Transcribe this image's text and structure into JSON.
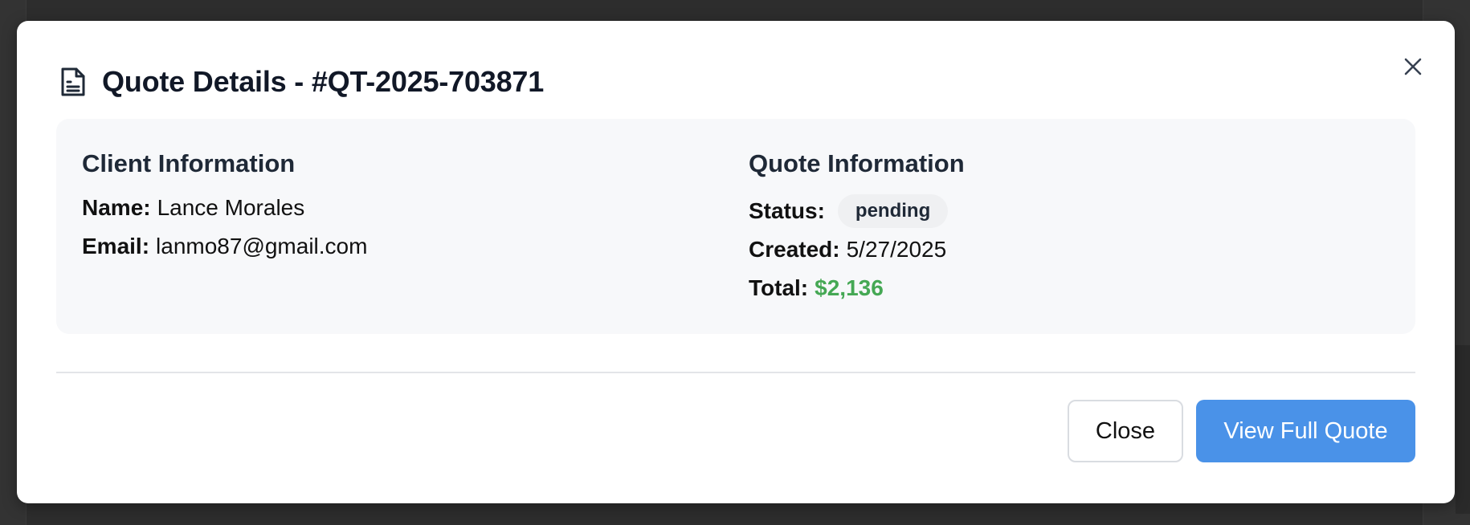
{
  "modal": {
    "title": "Quote Details - #QT-2025-703871",
    "icon": "document-icon",
    "close_icon": "close-icon"
  },
  "client_info": {
    "heading": "Client Information",
    "name_label": "Name:",
    "name_value": "Lance Morales",
    "email_label": "Email:",
    "email_value": "lanmo87@gmail.com"
  },
  "quote_info": {
    "heading": "Quote Information",
    "status_label": "Status:",
    "status_value": "pending",
    "created_label": "Created:",
    "created_value": "5/27/2025",
    "total_label": "Total:",
    "total_value": "$2,136"
  },
  "footer": {
    "close_label": "Close",
    "view_label": "View Full Quote"
  },
  "colors": {
    "primary": "#4a92e8",
    "total_green": "#45a854",
    "card_bg": "#f7f8fa",
    "backdrop": "#333333"
  }
}
